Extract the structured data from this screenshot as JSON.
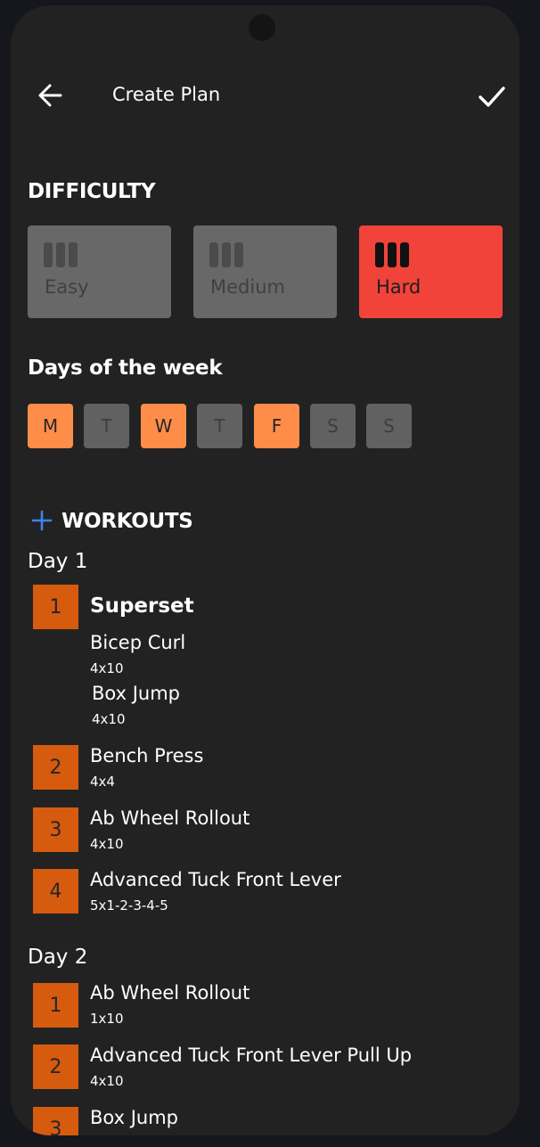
{
  "header": {
    "title": "Create Plan",
    "back_icon": "arrow-left-icon",
    "confirm_icon": "check-icon"
  },
  "difficulty": {
    "title": "DIFFICULTY",
    "options": [
      {
        "label": "Easy",
        "selected": false
      },
      {
        "label": "Medium",
        "selected": false
      },
      {
        "label": "Hard",
        "selected": true
      }
    ],
    "active_color": "#f2433b"
  },
  "days": {
    "title": "Days of the week",
    "items": [
      {
        "label": "M",
        "selected": true
      },
      {
        "label": "T",
        "selected": false
      },
      {
        "label": "W",
        "selected": true
      },
      {
        "label": "T",
        "selected": false
      },
      {
        "label": "F",
        "selected": true
      },
      {
        "label": "S",
        "selected": false
      },
      {
        "label": "S",
        "selected": false
      }
    ],
    "selected_color": "#ff8d4a"
  },
  "workouts": {
    "title": "WORKOUTS",
    "add_icon": "plus-icon",
    "add_color": "#3c83f0",
    "day1": {
      "heading": "Day 1",
      "items": [
        {
          "number": "1",
          "title": "Superset",
          "exercises": [
            {
              "name": "Bicep Curl",
              "sets": "4x10"
            },
            {
              "name": "Box Jump",
              "sets": "4x10"
            }
          ]
        },
        {
          "number": "2",
          "name": "Bench Press",
          "sets": "4x4"
        },
        {
          "number": "3",
          "name": "Ab Wheel Rollout",
          "sets": "4x10"
        },
        {
          "number": "4",
          "name": "Advanced Tuck Front Lever",
          "sets": "5x1-2-3-4-5"
        }
      ]
    },
    "day2": {
      "heading": "Day 2",
      "items": [
        {
          "number": "1",
          "name": "Ab Wheel Rollout",
          "sets": "1x10"
        },
        {
          "number": "2",
          "name": "Advanced Tuck Front Lever Pull Up",
          "sets": "4x10"
        },
        {
          "number": "3",
          "name": "Box Jump"
        }
      ]
    },
    "number_color": "#d65b0f"
  }
}
